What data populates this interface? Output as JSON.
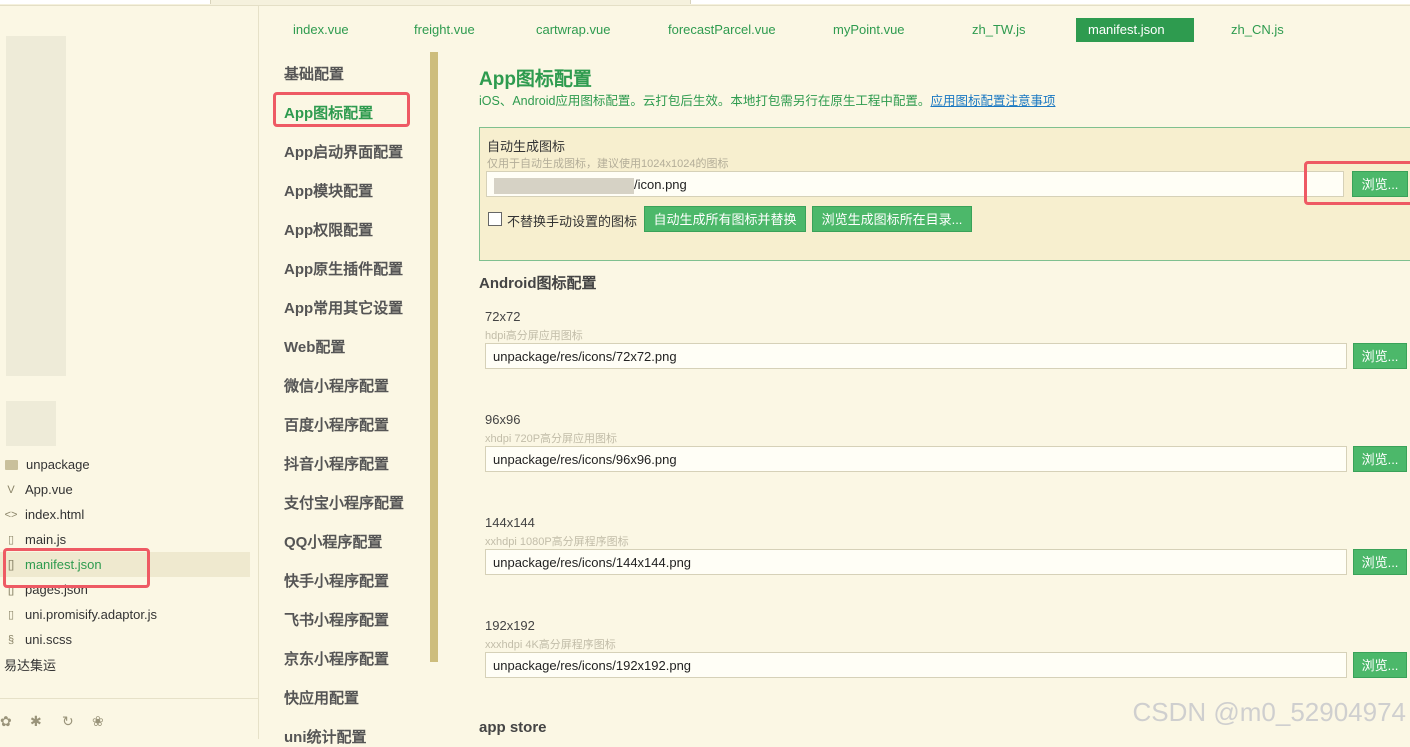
{
  "tabs": [
    {
      "label": "index.vue",
      "active": false
    },
    {
      "label": "freight.vue",
      "active": false
    },
    {
      "label": "cartwrap.vue",
      "active": false
    },
    {
      "label": "forecastParcel.vue",
      "active": false
    },
    {
      "label": "myPoint.vue",
      "active": false
    },
    {
      "label": "zh_TW.js",
      "active": false
    },
    {
      "label": "manifest.json",
      "active": true
    },
    {
      "label": "zh_CN.js",
      "active": false
    }
  ],
  "tree": {
    "items": [
      {
        "label": "unpackage",
        "icon": "folder-icon"
      },
      {
        "label": "App.vue",
        "icon": "vue-file-icon"
      },
      {
        "label": "index.html",
        "icon": "html-file-icon"
      },
      {
        "label": "main.js",
        "icon": "js-file-icon"
      },
      {
        "label": "manifest.json",
        "icon": "json-file-icon",
        "active": true
      },
      {
        "label": "pages.json",
        "icon": "json-file-icon"
      },
      {
        "label": "uni.promisify.adaptor.js",
        "icon": "js-file-icon"
      },
      {
        "label": "uni.scss",
        "icon": "scss-file-icon"
      }
    ],
    "project_label": "易达集运"
  },
  "nav": {
    "items": [
      "基础配置",
      "App图标配置",
      "App启动界面配置",
      "App模块配置",
      "App权限配置",
      "App原生插件配置",
      "App常用其它设置",
      "Web配置",
      "微信小程序配置",
      "百度小程序配置",
      "抖音小程序配置",
      "支付宝小程序配置",
      "QQ小程序配置",
      "快手小程序配置",
      "飞书小程序配置",
      "京东小程序配置",
      "快应用配置",
      "uni统计配置"
    ],
    "active": "App图标配置"
  },
  "main": {
    "title": "App图标配置",
    "subtitle": "iOS、Android应用图标配置。云打包后生效。本地打包需另行在原生工程中配置。",
    "subtitle_link": "应用图标配置注意事项",
    "auto": {
      "label": "自动生成图标",
      "hint": "仅用于自动生成图标，建议使用1024x1024的图标",
      "path_value": "/icon.png",
      "browse": "浏览...",
      "checkbox_label": "不替换手动设置的图标",
      "gen_all": "自动生成所有图标并替换",
      "browse_dir": "浏览生成图标所在目录..."
    },
    "android_title": "Android图标配置",
    "icons": [
      {
        "size": "72x72",
        "hint": "hdpi高分屏应用图标",
        "path": "unpackage/res/icons/72x72.png",
        "browse": "浏览..."
      },
      {
        "size": "96x96",
        "hint": "xhdpi 720P高分屏应用图标",
        "path": "unpackage/res/icons/96x96.png",
        "browse": "浏览..."
      },
      {
        "size": "144x144",
        "hint": "xxhdpi 1080P高分屏程序图标",
        "path": "unpackage/res/icons/144x144.png",
        "browse": "浏览..."
      },
      {
        "size": "192x192",
        "hint": "xxxhdpi 4K高分屏程序图标",
        "path": "unpackage/res/icons/192x192.png",
        "browse": "浏览..."
      }
    ],
    "appstore_title": "app store"
  },
  "watermark": "CSDN @m0_52904974",
  "colors": {
    "accent": "#2e9b4f",
    "button": "#4cb86a",
    "highlight": "#ee5a64",
    "background": "#fbf7e4"
  }
}
